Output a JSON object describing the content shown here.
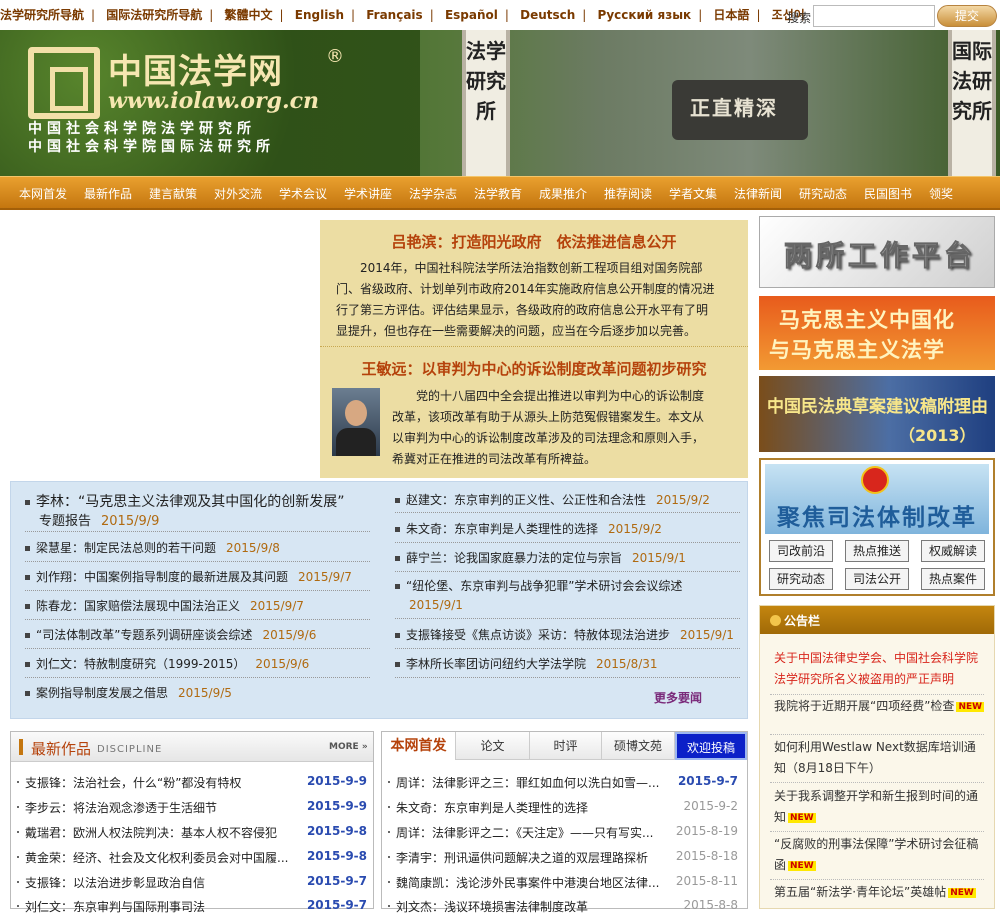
{
  "top": {
    "links": [
      "法学研究所导航",
      "国际法研究所导航",
      "繁體中文",
      "English",
      "Français",
      "Español",
      "Deutsch",
      "Русский язык",
      "日本語",
      "조선어"
    ],
    "search_label": "搜索",
    "search_placeholder": "",
    "search_button": "提交"
  },
  "banner": {
    "site_title": "中国法学网",
    "registered": "®",
    "url": "www.iolaw.org.cn",
    "sub1": "中国社会科学院法学研究所",
    "sub2": "中国社会科学院国际法研究所",
    "sign1": "法学研究所",
    "sign2": "国际法研究所",
    "stone": "正直精深"
  },
  "nav": [
    "本网首发",
    "最新作品",
    "建言献策",
    "对外交流",
    "学术会议",
    "学术讲座",
    "法学杂志",
    "法学教育",
    "成果推介",
    "推荐阅读",
    "学者文集",
    "法律新闻",
    "研究动态",
    "民国图书",
    "领奖"
  ],
  "feature": {
    "title1": "吕艳滨：打造阳光政府　依法推进信息公开",
    "body1": [
      "　　2014年，中国社科院法学所法治指数创新工程项目组对国务院部",
      "门、省级政府、计划单列市政府2014年实施政府信息公开制度的情况进",
      "行了第三方评估。评估结果显示，各级政府的政府信息公开水平有了明",
      "显提升，但也存在一些需要解决的问题，应当在今后逐步加以完善。"
    ],
    "title2": "王敏远：以审判为中心的诉讼制度改革问题初步研究",
    "body2": [
      "　　党的十八届四中全会提出推进以审判为中心的诉讼制度",
      "改革，该项改革有助于从源头上防范冤假错案发生。本文从",
      "以审判为中心的诉讼制度改革涉及的司法理念和原则入手，",
      "希冀对正在推进的司法改革有所裨益。"
    ]
  },
  "news_left": [
    {
      "title": "李林：“马克思主义法律观及其中国化的创新发展”",
      "title2": "专题报告",
      "date": "2015/9/9"
    },
    {
      "title": "梁慧星：制定民法总则的若干问题",
      "date": "2015/9/8"
    },
    {
      "title": "刘作翔：中国案例指导制度的最新进展及其问题",
      "date": "2015/9/7"
    },
    {
      "title": "陈春龙：国家赔偿法展现中国法治正义",
      "date": "2015/9/7"
    },
    {
      "title": "“司法体制改革”专题系列调研座谈会综述",
      "date": "2015/9/6"
    },
    {
      "title": "刘仁文：特赦制度研究（1999-2015）",
      "date": "2015/9/6"
    },
    {
      "title": "案例指导制度发展之借思",
      "date": "2015/9/5"
    }
  ],
  "news_right": [
    {
      "title": "赵建文：东京审判的正义性、公正性和合法性",
      "date": "2015/9/2"
    },
    {
      "title": "朱文奇：东京审判是人类理性的选择",
      "date": "2015/9/2"
    },
    {
      "title": "薛宁兰：论我国家庭暴力法的定位与宗旨",
      "date": "2015/9/1"
    },
    {
      "title": "“纽伦堡、东京审判与战争犯罪”学术研讨会会议综述",
      "title2": "2015/9/1",
      "date": ""
    },
    {
      "title": "支振锋接受《焦点访谈》采访：特赦体现法治进步",
      "date": "2015/9/1"
    },
    {
      "title": "李林所长率团访问纽约大学法学院",
      "date": "2015/8/31"
    }
  ],
  "news_more": "更多要闻",
  "right_banners": {
    "rb1": "两所工作平台",
    "rb2_line1": "马克思主义中国化",
    "rb2_line2": "与马克思主义法学",
    "rb3_line1": "中国民法典草案建议稿附理由",
    "rb3_line2": "（2013）",
    "reform_title": "聚焦司法体制改革",
    "reform_links": [
      "司改前沿",
      "热点推送",
      "权威解读",
      "研究动态",
      "司法公开",
      "热点案件"
    ]
  },
  "notice": {
    "title": "公告栏",
    "items": [
      {
        "text": "关于中国法律史学会、中国社会科学院法学研究所名义被盗用的严正声明",
        "new": ""
      },
      {
        "text": "我院将于近期开展“四项经费”检查",
        "new": "NEW"
      },
      {
        "text": "如何利用Westlaw Next数据库培训通知（8月18日下午）",
        "new": ""
      },
      {
        "text": "关于我系调整开学和新生报到时间的通知",
        "new": "NEW"
      },
      {
        "text": "“反腐败的刑事法保障”学术研讨会征稿函",
        "new": "NEW"
      },
      {
        "text": "第五届“新法学·青年论坛”英雄帖",
        "new": "NEW"
      }
    ]
  },
  "latest": {
    "title": "最新作品",
    "sub": "DISCIPLINE",
    "more": "MORE »",
    "items": [
      {
        "title": "支振锋：法治社会，什么“粉”都没有特权",
        "date": "2015-9-9"
      },
      {
        "title": "李步云：将法治观念渗透于生活细节",
        "date": "2015-9-9"
      },
      {
        "title": "戴瑞君：欧洲人权法院判决：基本人权不容侵犯",
        "date": "2015-9-8"
      },
      {
        "title": "黄金荣：经济、社会及文化权利委员会对中国履...",
        "date": "2015-9-8"
      },
      {
        "title": "支振锋：以法治进步彰显政治自信",
        "date": "2015-9-7"
      },
      {
        "title": "刘仁文：东京审判与国际刑事司法",
        "date": "2015-9-7"
      }
    ]
  },
  "tabs": {
    "labels": [
      "本网首发",
      "论文",
      "时评",
      "硕博文苑",
      "欢迎投稿"
    ],
    "items": [
      {
        "title": "周详：法律影评之三：罪红如血何以洗白如雪—...",
        "date": "2015-9-7"
      },
      {
        "title": "朱文奇：东京审判是人类理性的选择",
        "date": "2015-9-2"
      },
      {
        "title": "周详：法律影评之二：《天注定》——只有写实...",
        "date": "2015-8-19"
      },
      {
        "title": "李清宇：刑讯逼供问题解决之道的双层理路探析",
        "date": "2015-8-18"
      },
      {
        "title": "魏简康凯：浅论涉外民事案件中港澳台地区法律...",
        "date": "2015-8-11"
      },
      {
        "title": "刘文杰：浅议环境损害法律制度改革",
        "date": "2015-8-8"
      }
    ]
  }
}
